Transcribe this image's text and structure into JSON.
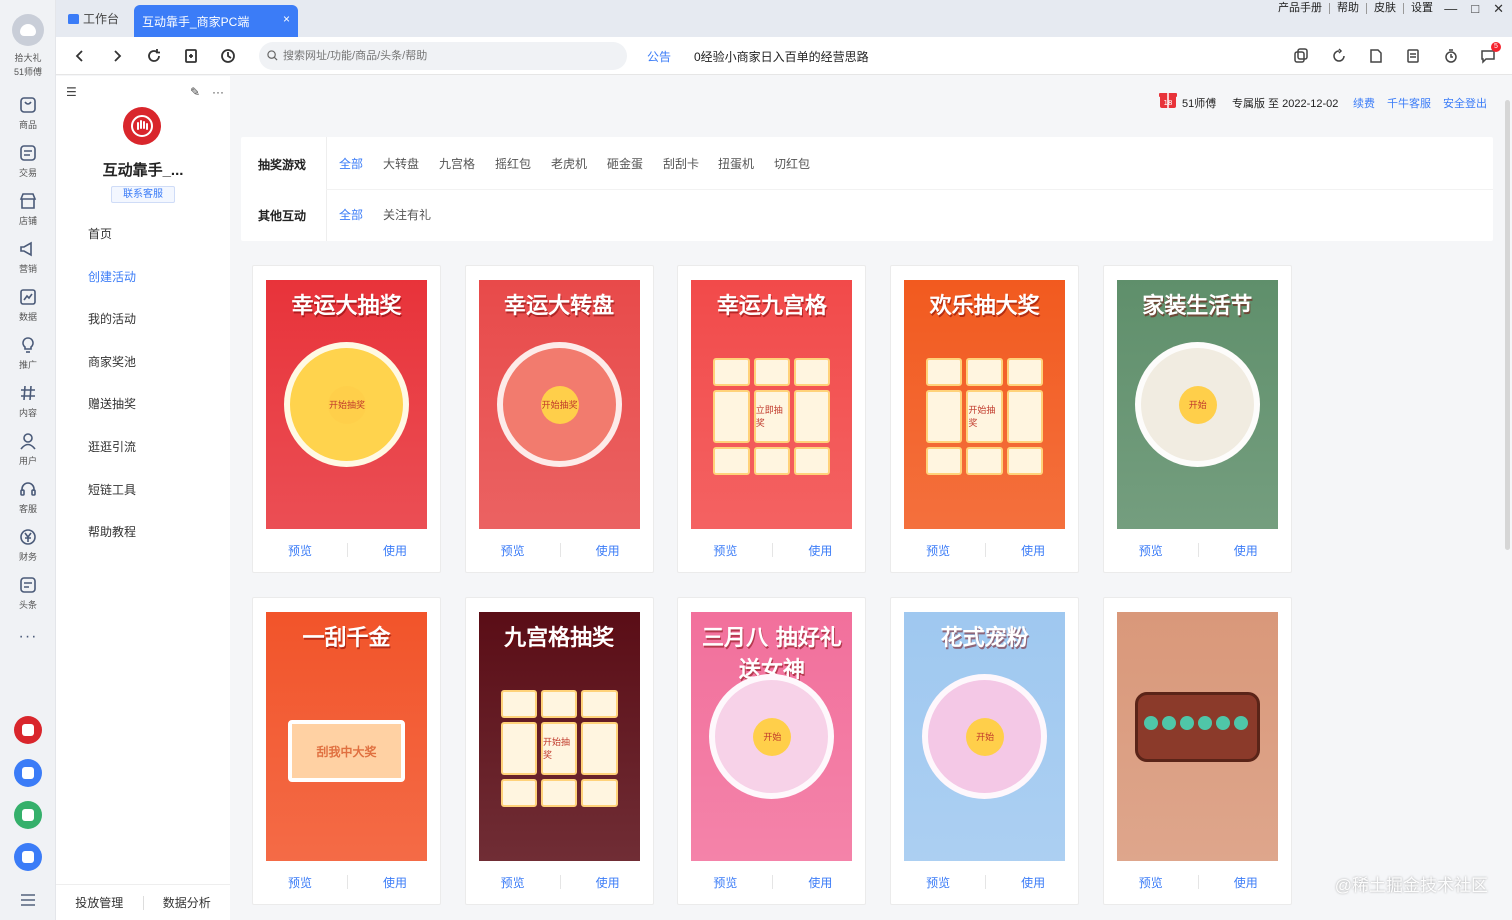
{
  "rail": {
    "user_name": "拾大礼",
    "user_sub": "51师傅",
    "items": [
      {
        "label": "商品",
        "icon": "goods-icon"
      },
      {
        "label": "交易",
        "icon": "trade-icon"
      },
      {
        "label": "店铺",
        "icon": "shop-icon"
      },
      {
        "label": "营销",
        "icon": "megaphone-icon"
      },
      {
        "label": "数据",
        "icon": "chart-icon"
      },
      {
        "label": "推广",
        "icon": "bulb-icon"
      },
      {
        "label": "内容",
        "icon": "hashtag-icon"
      },
      {
        "label": "用户",
        "icon": "user-icon"
      },
      {
        "label": "客服",
        "icon": "headset-icon"
      },
      {
        "label": "财务",
        "icon": "yen-icon"
      },
      {
        "label": "头条",
        "icon": "news-icon"
      }
    ],
    "more": "···"
  },
  "tabs": {
    "home": "工作台",
    "active": "互动靠手_商家PC端",
    "close": "×"
  },
  "sys_links": [
    "产品手册",
    "帮助",
    "皮肤",
    "设置"
  ],
  "window_controls": [
    "—",
    "□",
    "✕"
  ],
  "address": {
    "placeholder": "搜索网址/功能/商品/头条/帮助",
    "notice_label": "公告",
    "notice_text": "0经验小商家日入百单的经营思路",
    "badge": "5"
  },
  "side": {
    "shop_name": "互动靠手_...",
    "service": "联系客服",
    "menu": [
      "首页",
      "创建活动",
      "我的活动",
      "商家奖池",
      "赠送抽奖",
      "逛逛引流",
      "短链工具",
      "帮助教程"
    ],
    "active_index": 1,
    "bottom": [
      "投放管理",
      "数据分析"
    ]
  },
  "header": {
    "account": "51师傅",
    "edition": "专属版 至 2022-12-02",
    "renew": "续费",
    "qianniu": "千牛客服",
    "logout": "安全登出"
  },
  "filters": {
    "row1_label": "抽奖游戏",
    "row1_options": [
      "全部",
      "大转盘",
      "九宫格",
      "摇红包",
      "老虎机",
      "砸金蛋",
      "刮刮卡",
      "扭蛋机",
      "切红包"
    ],
    "row2_label": "其他互动",
    "row2_options": [
      "全部",
      "关注有礼"
    ]
  },
  "cards": [
    {
      "title": "幸运大抽奖",
      "style": "wheel",
      "bg": "#e8333a",
      "accent": "#ffd34d",
      "center": "开始抽奖"
    },
    {
      "title": "幸运大转盘",
      "style": "wheel",
      "bg": "#e84a4a",
      "accent": "#f27b6e",
      "center": "开始抽奖"
    },
    {
      "title": "幸运九宫格",
      "style": "grid",
      "bg": "#f24a4a",
      "accent": "#ffe3a8",
      "center": "立即抽奖"
    },
    {
      "title": "欢乐抽大奖",
      "style": "grid",
      "bg": "#f25a1f",
      "accent": "#ffe3a8",
      "center": "开始抽奖"
    },
    {
      "title": "家装生活节",
      "style": "wheel",
      "bg": "#5f8f6b",
      "accent": "#f1ece1",
      "center": "开始"
    },
    {
      "title": "一刮千金",
      "style": "scratch",
      "bg": "#f2542a",
      "accent": "#ffd1a3",
      "center": "刮我中大奖"
    },
    {
      "title": "九宫格抽奖",
      "style": "grid",
      "bg": "#5a0d16",
      "accent": "#ffd34d",
      "center": "开始抽奖"
    },
    {
      "title": "三月八 抽好礼送女神",
      "style": "wheel",
      "bg": "#f2709c",
      "accent": "#f7d2e8",
      "center": "开始"
    },
    {
      "title": "花式宠粉",
      "style": "wheel",
      "bg": "#9fc8f0",
      "accent": "#f4c8e6",
      "center": "开始"
    },
    {
      "title": "",
      "style": "egg",
      "bg": "#d9987a",
      "accent": "#4fc6a8",
      "center": ""
    }
  ],
  "card_actions": {
    "preview": "预览",
    "use": "使用"
  },
  "watermark": "@稀土掘金技术社区"
}
